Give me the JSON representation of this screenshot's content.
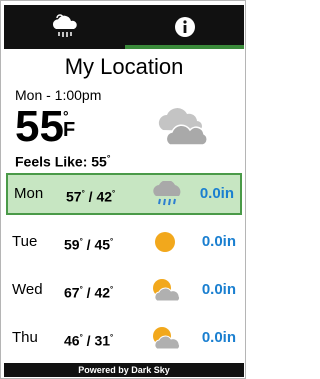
{
  "tabs": [
    {
      "name": "weather",
      "icon": "cloud-rain-icon",
      "active": true
    },
    {
      "name": "info",
      "icon": "info-icon",
      "active": false
    }
  ],
  "header": {
    "location": "My Location",
    "day_time": "Mon - 1:00pm",
    "temperature": "55",
    "degree_symbol": "°",
    "unit": "F",
    "feels_like_label": "Feels Like:",
    "feels_like_value": "55",
    "condition_icon": "partly-cloudy-icon"
  },
  "forecast": [
    {
      "day": "Mon",
      "high": "57",
      "low": "42",
      "icon": "rain-cloud-icon",
      "precip": "0.0in",
      "selected": true
    },
    {
      "day": "Tue",
      "high": "59",
      "low": "45",
      "icon": "sun-icon",
      "precip": "0.0in",
      "selected": false
    },
    {
      "day": "Wed",
      "high": "67",
      "low": "42",
      "icon": "partly-sunny-icon",
      "precip": "0.0in",
      "selected": false
    },
    {
      "day": "Thu",
      "high": "46",
      "low": "31",
      "icon": "partly-sunny-icon",
      "precip": "0.0in",
      "selected": false
    }
  ],
  "footer": {
    "text": "Powered by Dark Sky"
  },
  "colors": {
    "tab_bg": "#111111",
    "accent_green": "#4a9a48",
    "selected_row_bg": "#c7e6c2",
    "precip_blue": "#1a7fd0",
    "sun_orange": "#f2a81c"
  }
}
